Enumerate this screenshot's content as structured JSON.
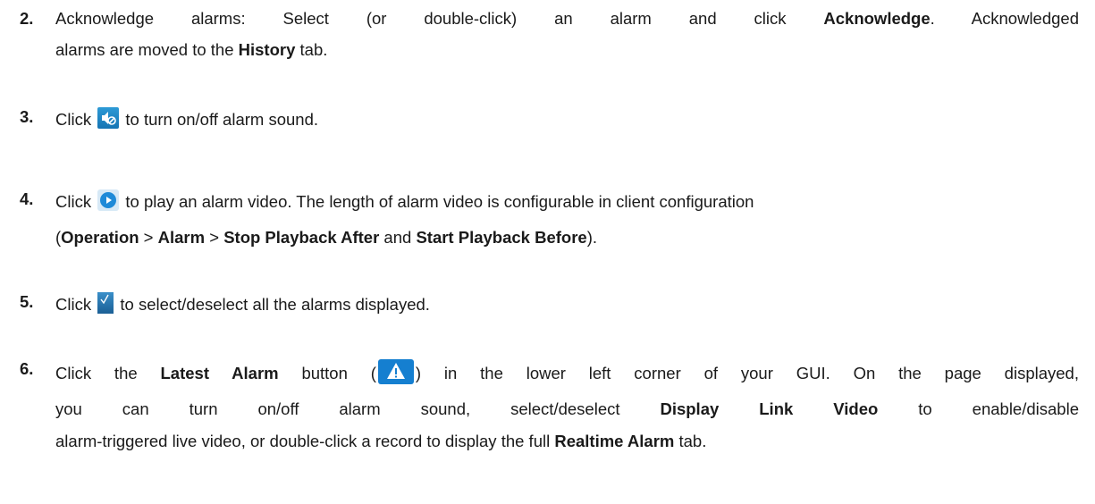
{
  "steps": [
    {
      "num": "2.",
      "l1a": "Acknowledge alarms: Select (or double-click) an alarm and click ",
      "l1b": "Acknowledge",
      "l1c": ". Acknowledged",
      "l2a": "alarms are moved to the ",
      "l2b": "History",
      "l2c": " tab."
    },
    {
      "num": "3.",
      "a": "Click ",
      "icon": "mute-speaker-icon",
      "b": " to turn on/off alarm sound."
    },
    {
      "num": "4.",
      "a": "Click ",
      "icon": "play-icon",
      "b": " to play an alarm video. The length of alarm video is configurable in client configuration",
      "l2a": "(",
      "l2b": "Operation",
      "l2c": " > ",
      "l2d": "Alarm",
      "l2e": " > ",
      "l2f": "Stop Playback After",
      "l2g": " and ",
      "l2h": "Start Playback Before",
      "l2i": ")."
    },
    {
      "num": "5.",
      "a": "Click ",
      "icon": "checkmark-icon",
      "b": " to select/deselect all the alarms displayed."
    },
    {
      "num": "6.",
      "l1a": "Click the ",
      "l1b": "Latest Alarm",
      "l1c": " button (",
      "icon": "warning-triangle-icon",
      "l1d": ") in the lower left corner of your GUI. On the page displayed,",
      "l2a": "you can turn on/off alarm sound, select/deselect ",
      "l2b": "Display Link Video",
      "l2c": " to enable/disable",
      "l3a": "alarm-triggered live video, or double-click a record to display the full ",
      "l3b": "Realtime Alarm",
      "l3c": " tab."
    }
  ]
}
